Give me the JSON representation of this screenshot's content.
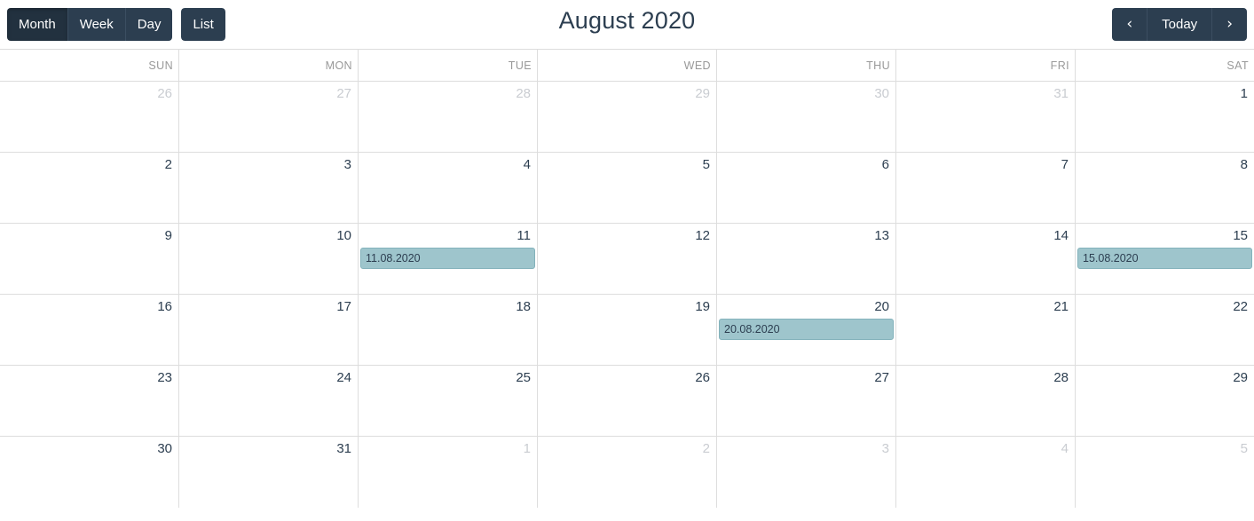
{
  "toolbar": {
    "view_buttons": [
      {
        "label": "Month",
        "name": "month-view-button",
        "active": true
      },
      {
        "label": "Week",
        "name": "week-view-button",
        "active": false
      },
      {
        "label": "Day",
        "name": "day-view-button",
        "active": false
      }
    ],
    "list_button": {
      "label": "List",
      "name": "list-view-button"
    },
    "title": "August 2020",
    "prev_icon": "‹",
    "next_icon": "›",
    "today_label": "Today"
  },
  "colors": {
    "button_bg": "#2c3e50",
    "button_active_bg": "#22313f",
    "title_text": "#2c3e50",
    "grid_border": "#dddddd",
    "weekday_text": "#999999",
    "day_text": "#2c3e50",
    "other_month_text": "#c9ccd1",
    "event_bg": "#9ec5cc",
    "event_border": "#83b2bb",
    "event_text": "#2c3e50"
  },
  "calendar": {
    "weekdays": [
      "SUN",
      "MON",
      "TUE",
      "WED",
      "THU",
      "FRI",
      "SAT"
    ],
    "weeks": [
      [
        {
          "day": "26",
          "other_month": true,
          "events": []
        },
        {
          "day": "27",
          "other_month": true,
          "events": []
        },
        {
          "day": "28",
          "other_month": true,
          "events": []
        },
        {
          "day": "29",
          "other_month": true,
          "events": []
        },
        {
          "day": "30",
          "other_month": true,
          "events": []
        },
        {
          "day": "31",
          "other_month": true,
          "events": []
        },
        {
          "day": "1",
          "other_month": false,
          "events": []
        }
      ],
      [
        {
          "day": "2",
          "other_month": false,
          "events": []
        },
        {
          "day": "3",
          "other_month": false,
          "events": []
        },
        {
          "day": "4",
          "other_month": false,
          "events": []
        },
        {
          "day": "5",
          "other_month": false,
          "events": []
        },
        {
          "day": "6",
          "other_month": false,
          "events": []
        },
        {
          "day": "7",
          "other_month": false,
          "events": []
        },
        {
          "day": "8",
          "other_month": false,
          "events": []
        }
      ],
      [
        {
          "day": "9",
          "other_month": false,
          "events": []
        },
        {
          "day": "10",
          "other_month": false,
          "events": []
        },
        {
          "day": "11",
          "other_month": false,
          "events": [
            "11.08.2020"
          ]
        },
        {
          "day": "12",
          "other_month": false,
          "events": []
        },
        {
          "day": "13",
          "other_month": false,
          "events": []
        },
        {
          "day": "14",
          "other_month": false,
          "events": []
        },
        {
          "day": "15",
          "other_month": false,
          "events": [
            "15.08.2020"
          ]
        }
      ],
      [
        {
          "day": "16",
          "other_month": false,
          "events": []
        },
        {
          "day": "17",
          "other_month": false,
          "events": []
        },
        {
          "day": "18",
          "other_month": false,
          "events": []
        },
        {
          "day": "19",
          "other_month": false,
          "events": []
        },
        {
          "day": "20",
          "other_month": false,
          "events": [
            "20.08.2020"
          ]
        },
        {
          "day": "21",
          "other_month": false,
          "events": []
        },
        {
          "day": "22",
          "other_month": false,
          "events": []
        }
      ],
      [
        {
          "day": "23",
          "other_month": false,
          "events": []
        },
        {
          "day": "24",
          "other_month": false,
          "events": []
        },
        {
          "day": "25",
          "other_month": false,
          "events": []
        },
        {
          "day": "26",
          "other_month": false,
          "events": []
        },
        {
          "day": "27",
          "other_month": false,
          "events": []
        },
        {
          "day": "28",
          "other_month": false,
          "events": []
        },
        {
          "day": "29",
          "other_month": false,
          "events": []
        }
      ],
      [
        {
          "day": "30",
          "other_month": false,
          "events": []
        },
        {
          "day": "31",
          "other_month": false,
          "events": []
        },
        {
          "day": "1",
          "other_month": true,
          "events": []
        },
        {
          "day": "2",
          "other_month": true,
          "events": []
        },
        {
          "day": "3",
          "other_month": true,
          "events": []
        },
        {
          "day": "4",
          "other_month": true,
          "events": []
        },
        {
          "day": "5",
          "other_month": true,
          "events": []
        }
      ]
    ]
  }
}
